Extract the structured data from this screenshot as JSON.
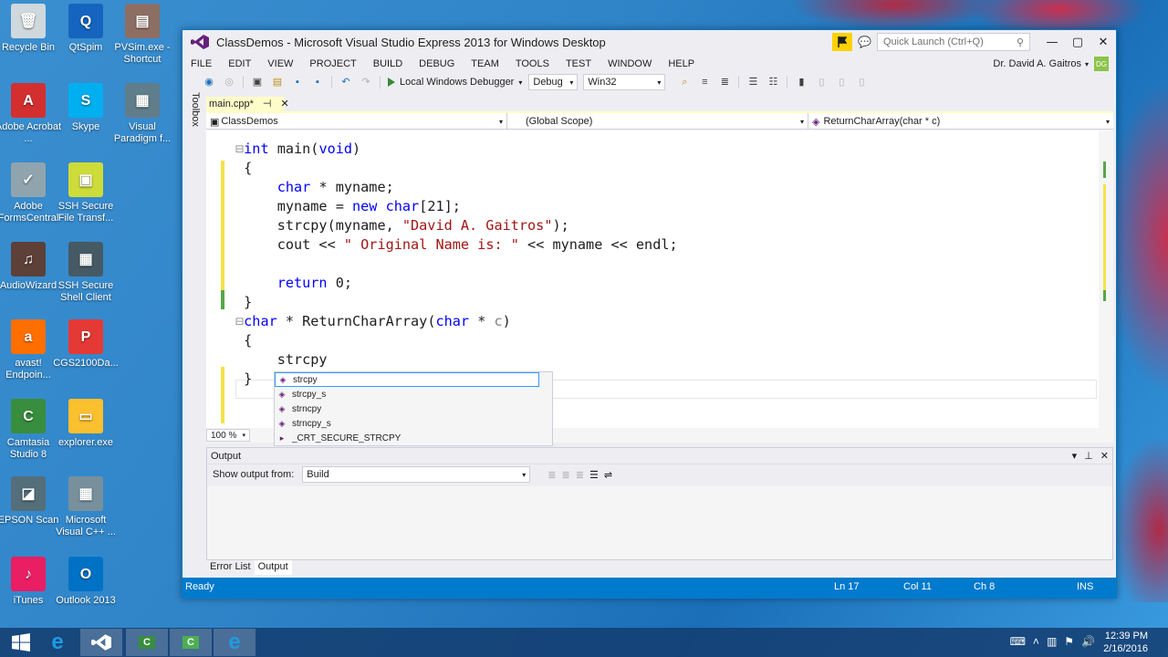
{
  "desktop": {
    "icons": [
      {
        "label": "Recycle Bin",
        "glyph": "🗑",
        "color": "#cfd8dc"
      },
      {
        "label": "QtSpim",
        "glyph": "Q",
        "color": "#1565c0"
      },
      {
        "label": "PVSim.exe - Shortcut",
        "glyph": "▤",
        "color": "#8d6e63"
      },
      {
        "label": "Adobe Acrobat ...",
        "glyph": "A",
        "color": "#d32f2f"
      },
      {
        "label": "Skype",
        "glyph": "S",
        "color": "#00aff0"
      },
      {
        "label": "Visual Paradigm f...",
        "glyph": "▦",
        "color": "#607d8b"
      },
      {
        "label": "Adobe FormsCentral",
        "glyph": "✓",
        "color": "#90a4ae"
      },
      {
        "label": "SSH Secure File Transf...",
        "glyph": "▣",
        "color": "#cddc39"
      },
      {
        "label": "AudioWizard",
        "glyph": "♫",
        "color": "#5d4037"
      },
      {
        "label": "SSH Secure Shell Client",
        "glyph": "▦",
        "color": "#455a64"
      },
      {
        "label": "avast! Endpoin...",
        "glyph": "a",
        "color": "#ff6f00"
      },
      {
        "label": "CGS2100Da...",
        "glyph": "P",
        "color": "#e53935"
      },
      {
        "label": "Camtasia Studio 8",
        "glyph": "C",
        "color": "#388e3c"
      },
      {
        "label": "explorer.exe",
        "glyph": "▭",
        "color": "#fbc02d"
      },
      {
        "label": "EPSON Scan",
        "glyph": "◪",
        "color": "#546e7a"
      },
      {
        "label": "Microsoft Visual C++ ...",
        "glyph": "▦",
        "color": "#78909c"
      },
      {
        "label": "iTunes",
        "glyph": "♪",
        "color": "#e91e63"
      },
      {
        "label": "Outlook 2013",
        "glyph": "O",
        "color": "#0072c6"
      }
    ]
  },
  "window": {
    "title": "ClassDemos - Microsoft Visual Studio Express 2013 for Windows Desktop",
    "quick_launch_placeholder": "Quick Launch (Ctrl+Q)",
    "user_name": "Dr. David A. Gaitros",
    "user_initials": "DG"
  },
  "menu": [
    "FILE",
    "EDIT",
    "VIEW",
    "PROJECT",
    "BUILD",
    "DEBUG",
    "TEAM",
    "TOOLS",
    "TEST",
    "WINDOW",
    "HELP"
  ],
  "toolbar": {
    "debugger_label": "Local Windows Debugger",
    "config": "Debug",
    "platform": "Win32"
  },
  "toolbox_label": "Toolbox",
  "document": {
    "tab_name": "main.cpp*",
    "nav_project": "ClassDemos",
    "nav_scope": "(Global Scope)",
    "nav_member": "ReturnCharArray(char * c)",
    "zoom": "100 %"
  },
  "intellisense": {
    "items": [
      "strcpy",
      "strcpy_s",
      "strncpy",
      "strncpy_s",
      "_CRT_SECURE_STRCPY"
    ]
  },
  "output": {
    "title": "Output",
    "show_from_label": "Show output from:",
    "source": "Build"
  },
  "bottom_tabs": [
    "Error List",
    "Output"
  ],
  "status": {
    "state": "Ready",
    "line": "Ln 17",
    "col": "Col 11",
    "ch": "Ch 8",
    "mode": "INS"
  },
  "taskbar": {
    "time": "12:39 PM",
    "date": "2/16/2016"
  },
  "colors": {
    "accent": "#007acc",
    "keyword": "#0000ff",
    "string": "#a31515"
  }
}
